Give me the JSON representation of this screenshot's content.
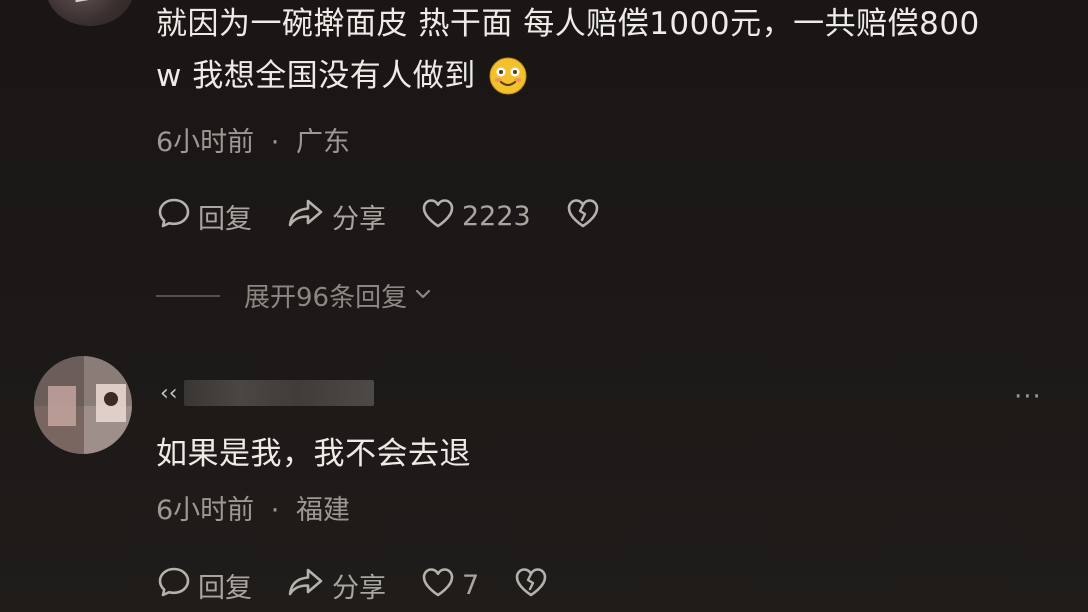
{
  "comment1": {
    "text_line1": "就因为一碗擀面皮 热干面 每人赔偿1000元，一共赔偿800",
    "text_line2": "w 我想全国没有人做到",
    "emoji": "smiling-face-emoji",
    "time": "6小时前",
    "location": "广东",
    "reply_label": "回复",
    "share_label": "分享",
    "likes": "2223",
    "expand_replies": "展开96条回复"
  },
  "comment2": {
    "username_prefix": "‹‹",
    "text": "如果是我，我不会去退",
    "time": "6小时前",
    "location": "福建",
    "reply_label": "回复",
    "share_label": "分享",
    "likes": "7",
    "more": "···"
  },
  "separator": "·",
  "colors": {
    "background": "#1b1817",
    "text": "#eeebe7",
    "meta": "#9c9893",
    "emoji": "#f2c12e"
  }
}
